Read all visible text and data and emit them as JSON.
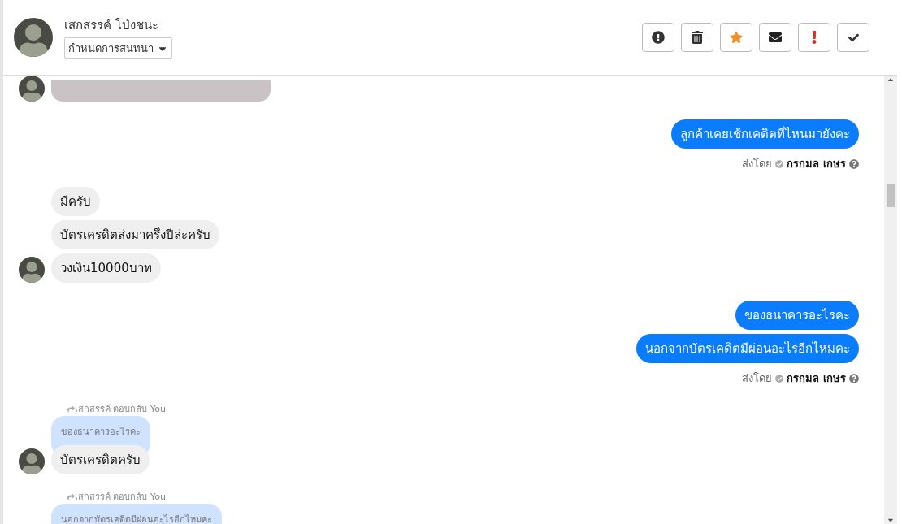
{
  "header": {
    "contact_name": "เสกสรรค์ โป่งชนะ",
    "conversation_menu": "กำหนดการสนทนา",
    "actions": [
      {
        "kind": "alert"
      },
      {
        "kind": "delete"
      },
      {
        "kind": "star",
        "on": true
      },
      {
        "kind": "mail"
      },
      {
        "kind": "important"
      },
      {
        "kind": "done"
      }
    ]
  },
  "messages": [
    {
      "kind": "image"
    },
    {
      "kind": "outgoing",
      "bubbles": [
        "ลูกค้าเคยเช้กเคดิตที่ไหนมายังคะ"
      ],
      "sent_by_label": "ส่งโดย",
      "agent": "กรกมล เกษร"
    },
    {
      "kind": "incoming",
      "bubbles": [
        "มีครับ",
        "บัตรเครดิตส่งมาครึ่งปีล่ะครับ",
        "วงเงิน10000บาท"
      ]
    },
    {
      "kind": "outgoing",
      "bubbles": [
        "ของธนาคารอะไรคะ",
        "นอกจากบัตรเคดิตมีผ่อนอะไรอีกไหมคะ"
      ],
      "sent_by_label": "ส่งโดย",
      "agent": "กรกมล เกษร"
    },
    {
      "kind": "reply",
      "reply_label": "เสกสรรค์ ตอบกลับ You",
      "quoted": "ของธนาคารอะไรคะ",
      "bubbles": [
        "บัตรเครดิตครับ"
      ]
    },
    {
      "kind": "reply",
      "reply_label": "เสกสรรค์ ตอบกลับ You",
      "quoted": "นอกจากบัตรเคดิตมีผ่อนอะไรอีกไหมคะ"
    }
  ]
}
